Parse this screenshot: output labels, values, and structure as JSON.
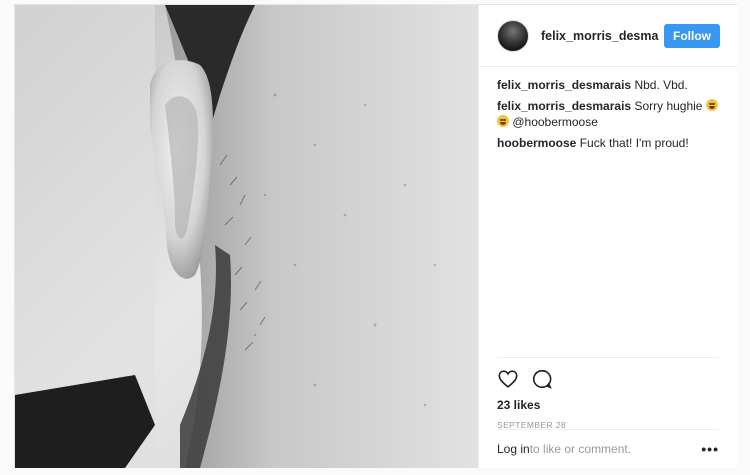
{
  "post": {
    "author": "felix_morris_desmarais",
    "follow_label": "Follow",
    "comments": [
      {
        "user": "felix_morris_desmarais",
        "text": "Nbd. Vbd."
      },
      {
        "user": "felix_morris_desmarais",
        "text": "Sorry hughie",
        "emojis": [
          "joy-emoji",
          "sweat-smile-emoji"
        ],
        "mention": "@hoobermoose"
      },
      {
        "user": "hoobermoose",
        "text": "Fuck that! I'm proud!"
      }
    ],
    "likes": "23 likes",
    "date": "SEPTEMBER 28",
    "login_link": "Log in",
    "login_rest": " to like or comment.",
    "more": "•••"
  },
  "icons": {
    "like": "heart-icon",
    "comment": "comment-bubble-icon",
    "more": "more-options-icon"
  },
  "colors": {
    "follow_button": "#3897f0",
    "muted_text": "#999999",
    "border": "#efefef"
  }
}
